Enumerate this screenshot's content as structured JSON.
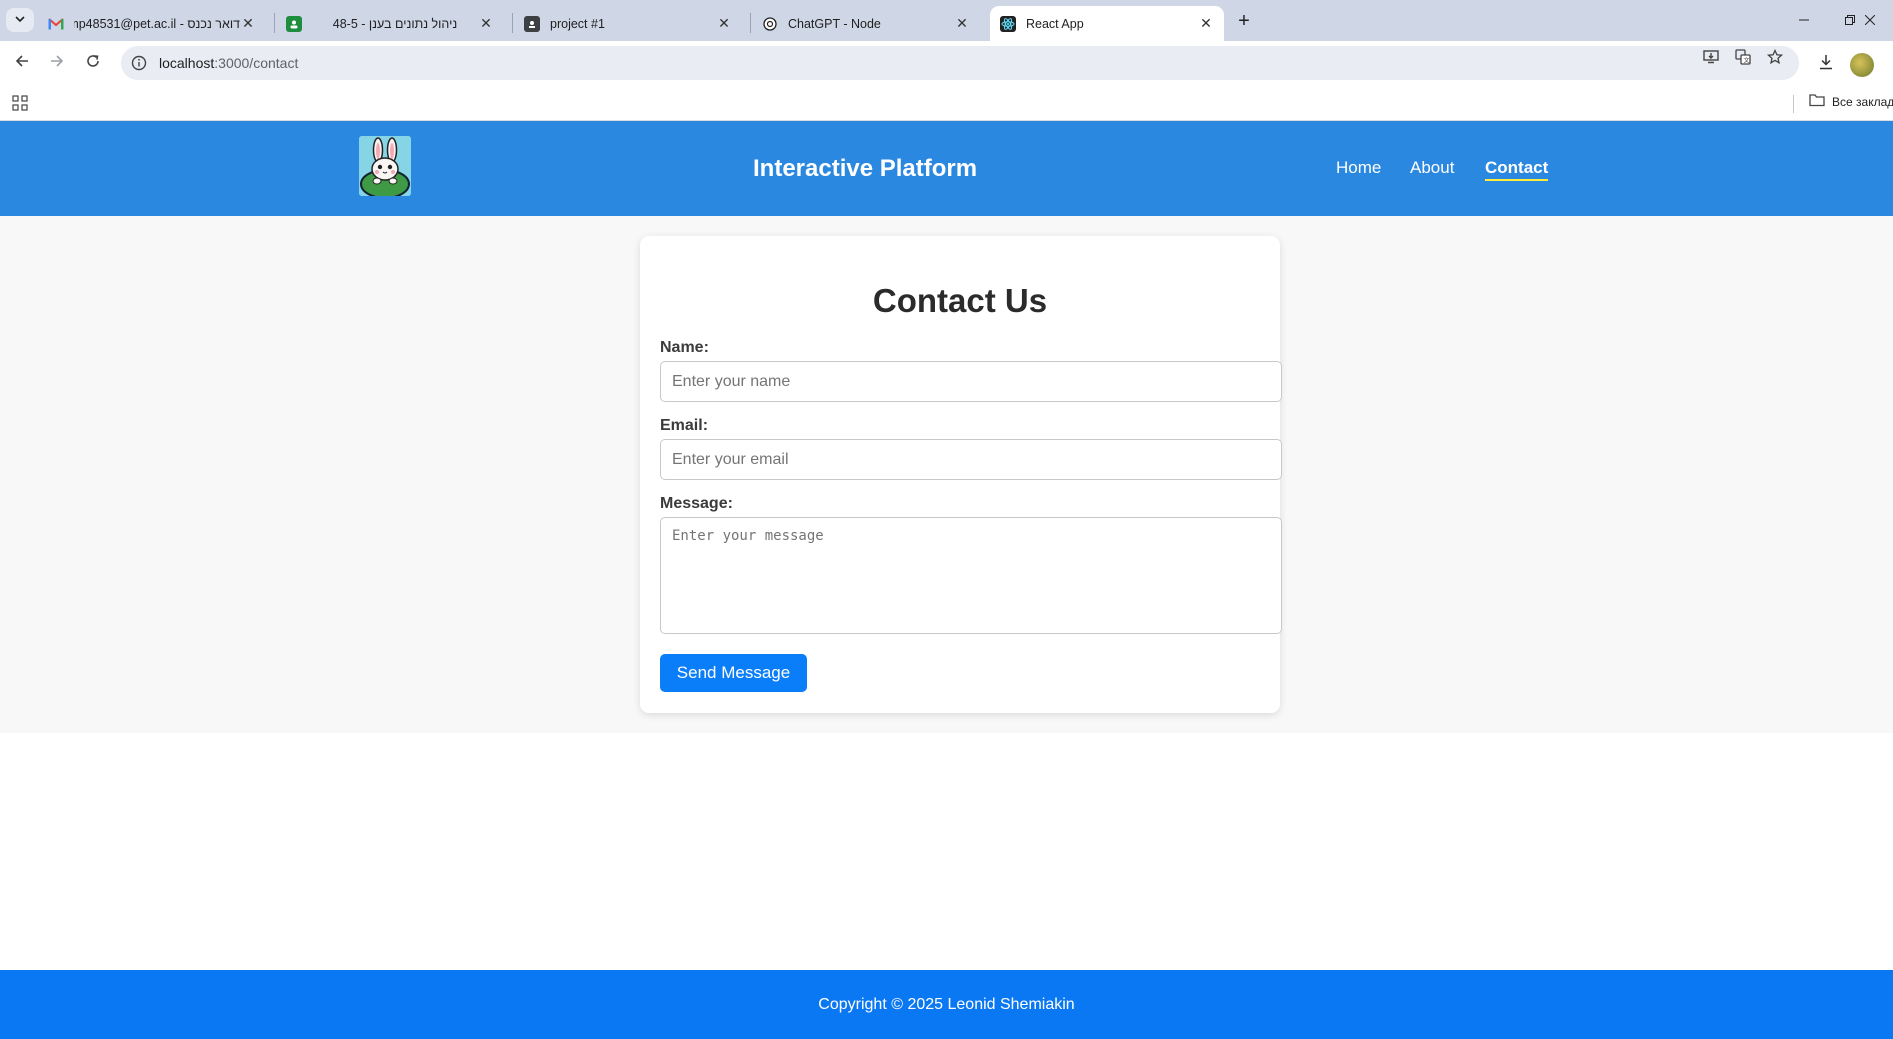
{
  "browser": {
    "tabs": [
      {
        "title": "דואר נכנס - mp48531@pet.ac.il",
        "favicon": "gmail-icon"
      },
      {
        "title": "ניהול נתונים בענן - 48-5",
        "favicon": "classroom-icon"
      },
      {
        "title": "project #1",
        "favicon": "contact-card-icon"
      },
      {
        "title": "ChatGPT - Node",
        "favicon": "chatgpt-icon"
      },
      {
        "title": "React App",
        "favicon": "react-icon",
        "active": true
      }
    ],
    "url_host": "localhost",
    "url_path": ":3000/contact",
    "bookmarks_folder": "Все заклад"
  },
  "site": {
    "title": "Interactive Platform",
    "nav": [
      {
        "label": "Home"
      },
      {
        "label": "About"
      },
      {
        "label": "Contact",
        "active": true
      }
    ]
  },
  "contact": {
    "heading": "Contact Us",
    "name_label": "Name:",
    "name_placeholder": "Enter your name",
    "email_label": "Email:",
    "email_placeholder": "Enter your email",
    "message_label": "Message:",
    "message_placeholder": "Enter your message",
    "submit_label": "Send Message"
  },
  "footer": {
    "text": "Copyright © 2025 Leonid Shemiakin"
  },
  "colors": {
    "header_bg": "#2a88e0",
    "footer_bg": "#0a78f2",
    "button_bg": "#0a7df8",
    "active_underline": "#ffeb3b"
  }
}
